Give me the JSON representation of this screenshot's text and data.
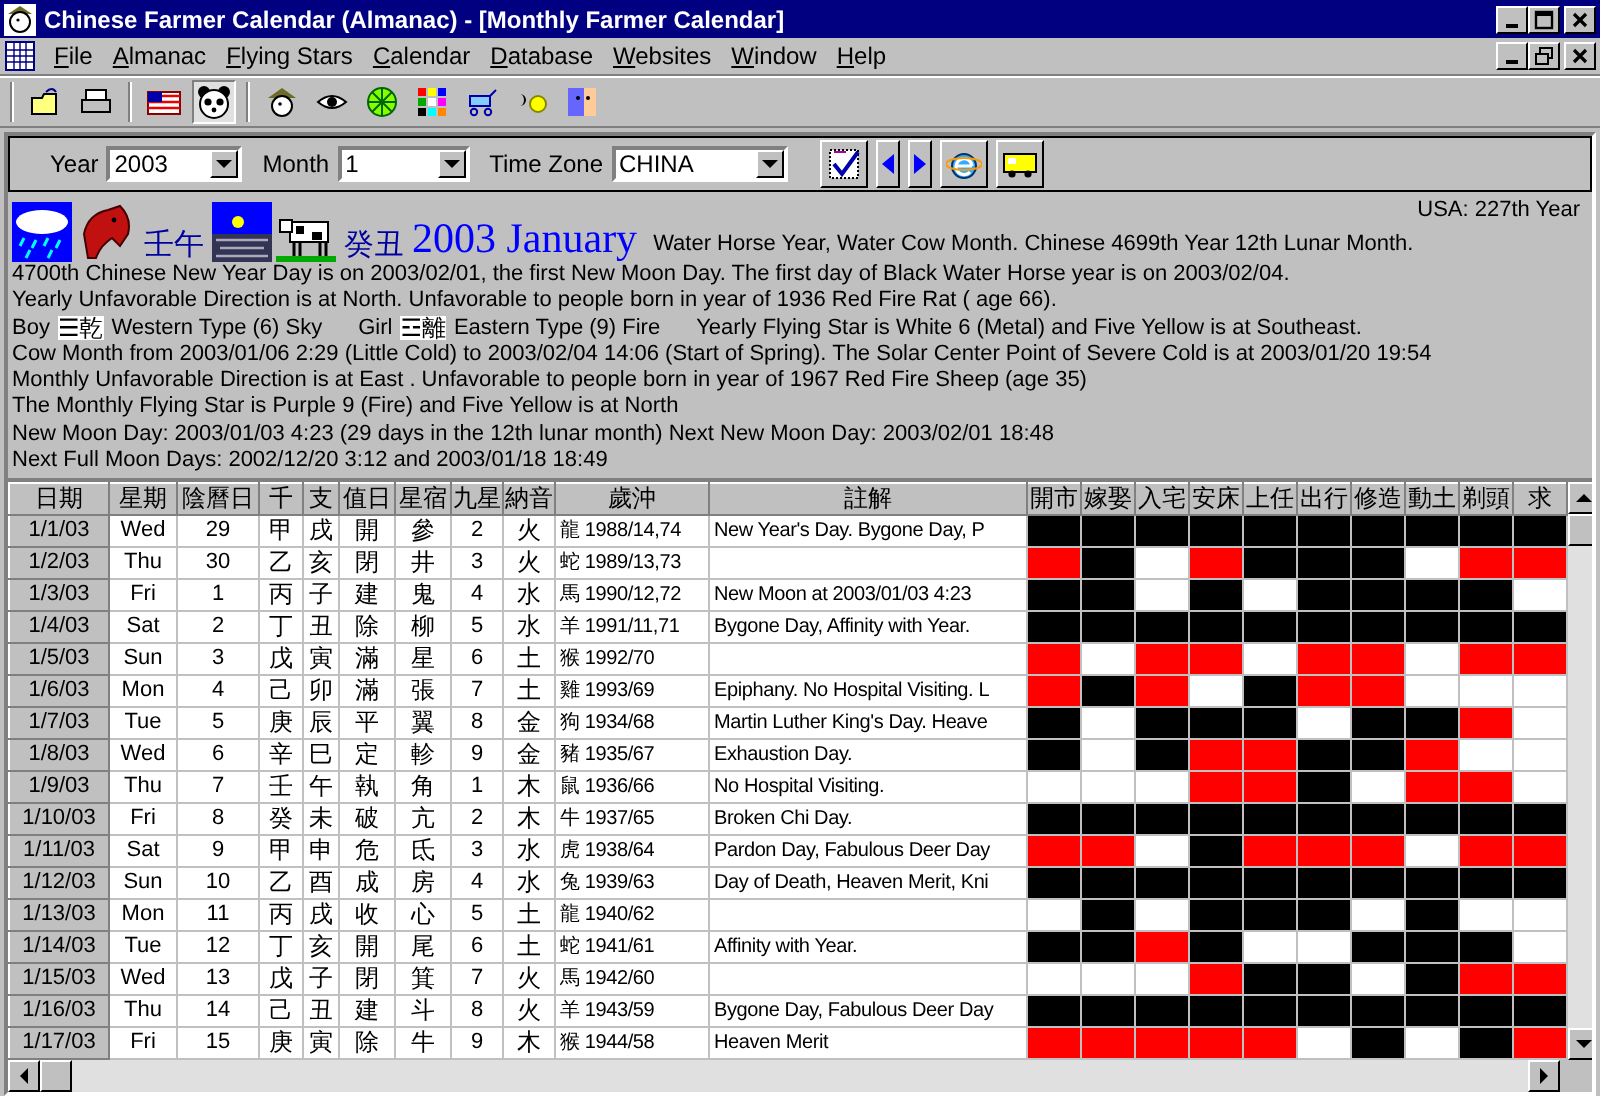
{
  "window": {
    "title": "Chinese Farmer Calendar (Almanac) - [Monthly Farmer Calendar]"
  },
  "menu": [
    "File",
    "Almanac",
    "Flying Stars",
    "Calendar",
    "Database",
    "Websites",
    "Window",
    "Help"
  ],
  "selectors": [
    {
      "label": "Year",
      "value": "2003"
    },
    {
      "label": "Month",
      "value": "1"
    },
    {
      "label": "Time Zone",
      "value": "CHINA"
    }
  ],
  "header": {
    "year_ganzhi": "壬午",
    "month_ganzhi": "癸丑",
    "heading": "2003 January",
    "summary": "Water Horse Year, Water Cow Month. Chinese 4699th Year 12th Lunar Month.",
    "usa_year": "USA: 227th Year",
    "lines_before": [
      "4700th Chinese New Year Day is on 2003/02/01, the first New Moon Day. The first day of Black Water Horse year is on 2003/02/04.",
      "Yearly Unfavorable Direction is at North. Unfavorable to people born in year of 1936 Red Fire Rat ( age 66)."
    ],
    "trigrams": [
      {
        "label": "Boy",
        "symbol": "☰",
        "name": "乾",
        "type": "Western Type (6) Sky"
      },
      {
        "label": "Girl",
        "symbol": "☲",
        "name": "離",
        "type": "Eastern Type (9) Fire"
      }
    ],
    "flying_star": "Yearly Flying Star is White 6 (Metal) and Five Yellow is at Southeast.",
    "lines_after": [
      "Cow Month from 2003/01/06 2:29 (Little Cold) to 2003/02/04 14:06 (Start of Spring). The Solar Center Point of Severe Cold is at 2003/01/20 19:54",
      "Monthly Unfavorable Direction is at East . Unfavorable to people born in year of 1967 Red Fire Sheep (age 35)",
      "The Monthly Flying Star is Purple 9 (Fire) and Five Yellow is at North",
      "New Moon Day: 2003/01/03 4:23 (29 days in the 12th lunar month) Next New Moon Day: 2003/02/01 18:48",
      "Next Full Moon Days: 2002/12/20 3:12 and 2003/01/18 18:49"
    ]
  },
  "table": {
    "columns": [
      "日期",
      "星期",
      "陰曆日",
      "千",
      "支",
      "值日",
      "星宿",
      "九星",
      "納音",
      "歲沖",
      "註解"
    ],
    "activity_columns": [
      "開市",
      "嫁娶",
      "入宅",
      "安床",
      "上任",
      "出行",
      "修造",
      "動土",
      "剃頭",
      "求"
    ],
    "rows": [
      {
        "cells": [
          "1/1/03",
          "Wed",
          "29",
          "甲",
          "戌",
          "開",
          "參",
          "2",
          "火",
          "龍 1988/14,74",
          "New Year's Day. Bygone Day, P"
        ],
        "marks": [
          {
            "color": "#000000"
          },
          {
            "color": "#000000"
          },
          {
            "color": "#000000"
          },
          {
            "color": "#000000"
          },
          {
            "color": "#000000"
          },
          {
            "color": "#000000"
          },
          {
            "color": "#000000"
          },
          {
            "color": "#000000"
          },
          {
            "color": "#000000"
          },
          {
            "color": "#000000"
          }
        ]
      },
      {
        "cells": [
          "1/2/03",
          "Thu",
          "30",
          "乙",
          "亥",
          "閉",
          "井",
          "3",
          "火",
          "蛇 1989/13,73"
        ],
        "marks": [
          {
            "color": "#ff0000"
          },
          {
            "color": "#000000"
          },
          {
            "color": "#ffffff"
          },
          {
            "color": "#ff0000"
          },
          {
            "color": "#000000"
          },
          {
            "color": "#000000"
          },
          {
            "color": "#000000"
          },
          {
            "color": "#ffffff"
          },
          {
            "color": "#ff0000"
          },
          {
            "color": "#ff0000"
          }
        ]
      },
      {
        "cells": [
          "1/3/03",
          "Fri",
          "1",
          "丙",
          "子",
          "建",
          "鬼",
          "4",
          "水",
          "馬 1990/12,72",
          "New Moon at 2003/01/03 4:23"
        ],
        "marks": [
          {
            "color": "#000000"
          },
          {
            "color": "#000000"
          },
          {
            "color": "#ffffff"
          },
          {
            "color": "#000000"
          },
          {
            "color": "#ffffff"
          },
          {
            "color": "#000000"
          },
          {
            "color": "#000000"
          },
          {
            "color": "#000000"
          },
          {
            "color": "#000000"
          },
          {
            "color": "#ffffff"
          }
        ]
      },
      {
        "cells": [
          "1/4/03",
          "Sat",
          "2",
          "丁",
          "丑",
          "除",
          "柳",
          "5",
          "水",
          "羊 1991/11,71",
          "Bygone Day, Affinity with Year."
        ],
        "marks": [
          {
            "color": "#000000"
          },
          {
            "color": "#000000"
          },
          {
            "color": "#000000"
          },
          {
            "color": "#000000"
          },
          {
            "color": "#000000"
          },
          {
            "color": "#000000"
          },
          {
            "color": "#000000"
          },
          {
            "color": "#000000"
          },
          {
            "color": "#000000"
          },
          {
            "color": "#000000"
          }
        ]
      },
      {
        "cells": [
          "1/5/03",
          "Sun",
          "3",
          "戊",
          "寅",
          "滿",
          "星",
          "6",
          "土",
          "猴 1992/70"
        ],
        "marks": [
          {
            "color": "#ff0000"
          },
          {
            "color": "#ffffff"
          },
          {
            "color": "#ff0000"
          },
          {
            "color": "#ff0000"
          },
          {
            "color": "#ffffff"
          },
          {
            "color": "#ff0000"
          },
          {
            "color": "#ff0000"
          },
          {
            "color": "#ffffff"
          },
          {
            "color": "#ff0000"
          },
          {
            "color": "#ff0000"
          }
        ]
      },
      {
        "cells": [
          "1/6/03",
          "Mon",
          "4",
          "己",
          "卯",
          "滿",
          "張",
          "7",
          "土",
          "雞 1993/69",
          "Epiphany. No Hospital Visiting. L"
        ],
        "marks": [
          {
            "color": "#ff0000"
          },
          {
            "color": "#000000"
          },
          {
            "color": "#ff0000"
          },
          {
            "color": "#ffffff"
          },
          {
            "color": "#000000"
          },
          {
            "color": "#ff0000"
          },
          {
            "color": "#ff0000"
          },
          {
            "color": "#ffffff"
          },
          {
            "color": "#ffffff"
          },
          {
            "color": "#ffffff"
          }
        ]
      },
      {
        "cells": [
          "1/7/03",
          "Tue",
          "5",
          "庚",
          "辰",
          "平",
          "翼",
          "8",
          "金",
          "狗 1934/68",
          "Martin Luther King's Day. Heave"
        ],
        "marks": [
          {
            "color": "#000000"
          },
          {
            "color": "#ffffff"
          },
          {
            "color": "#000000"
          },
          {
            "color": "#000000"
          },
          {
            "color": "#000000"
          },
          {
            "color": "#ffffff"
          },
          {
            "color": "#000000"
          },
          {
            "color": "#000000"
          },
          {
            "color": "#ff0000"
          },
          {
            "color": "#ffffff"
          }
        ]
      },
      {
        "cells": [
          "1/8/03",
          "Wed",
          "6",
          "辛",
          "巳",
          "定",
          "軫",
          "9",
          "金",
          "豬 1935/67",
          "Exhaustion Day."
        ],
        "marks": [
          {
            "color": "#000000"
          },
          {
            "color": "#ffffff"
          },
          {
            "color": "#000000"
          },
          {
            "color": "#ff0000"
          },
          {
            "color": "#ff0000"
          },
          {
            "color": "#000000"
          },
          {
            "color": "#000000"
          },
          {
            "color": "#ff0000"
          },
          {
            "color": "#ffffff"
          },
          {
            "color": "#ffffff"
          }
        ]
      },
      {
        "cells": [
          "1/9/03",
          "Thu",
          "7",
          "壬",
          "午",
          "執",
          "角",
          "1",
          "木",
          "鼠 1936/66",
          "No Hospital Visiting."
        ],
        "marks": [
          {
            "color": "#ffffff"
          },
          {
            "color": "#ffffff"
          },
          {
            "color": "#ffffff"
          },
          {
            "color": "#ff0000"
          },
          {
            "color": "#ff0000"
          },
          {
            "color": "#000000"
          },
          {
            "color": "#ffffff"
          },
          {
            "color": "#ff0000"
          },
          {
            "color": "#ff0000"
          },
          {
            "color": "#ffffff"
          }
        ]
      },
      {
        "cells": [
          "1/10/03",
          "Fri",
          "8",
          "癸",
          "未",
          "破",
          "亢",
          "2",
          "木",
          "牛 1937/65",
          "Broken Chi Day."
        ],
        "marks": [
          {
            "color": "#000000"
          },
          {
            "color": "#000000"
          },
          {
            "color": "#000000"
          },
          {
            "color": "#000000"
          },
          {
            "color": "#000000"
          },
          {
            "color": "#000000"
          },
          {
            "color": "#000000"
          },
          {
            "color": "#000000"
          },
          {
            "color": "#000000"
          },
          {
            "color": "#000000"
          }
        ]
      },
      {
        "cells": [
          "1/11/03",
          "Sat",
          "9",
          "甲",
          "申",
          "危",
          "氐",
          "3",
          "水",
          "虎 1938/64",
          "Pardon Day, Fabulous Deer Day"
        ],
        "marks": [
          {
            "color": "#ff0000"
          },
          {
            "color": "#ff0000"
          },
          {
            "color": "#ffffff"
          },
          {
            "color": "#000000"
          },
          {
            "color": "#ff0000"
          },
          {
            "color": "#ff0000"
          },
          {
            "color": "#ff0000"
          },
          {
            "color": "#ffffff"
          },
          {
            "color": "#ff0000"
          },
          {
            "color": "#ff0000"
          }
        ]
      },
      {
        "cells": [
          "1/12/03",
          "Sun",
          "10",
          "乙",
          "酉",
          "成",
          "房",
          "4",
          "水",
          "兔 1939/63",
          "Day of Death, Heaven Merit, Kni"
        ],
        "marks": [
          {
            "color": "#000000"
          },
          {
            "color": "#000000"
          },
          {
            "color": "#000000"
          },
          {
            "color": "#000000"
          },
          {
            "color": "#000000"
          },
          {
            "color": "#000000"
          },
          {
            "color": "#000000"
          },
          {
            "color": "#000000"
          },
          {
            "color": "#000000"
          },
          {
            "color": "#000000"
          }
        ]
      },
      {
        "cells": [
          "1/13/03",
          "Mon",
          "11",
          "丙",
          "戌",
          "收",
          "心",
          "5",
          "土",
          "龍 1940/62"
        ],
        "marks": [
          {
            "color": "#ffffff"
          },
          {
            "color": "#000000"
          },
          {
            "color": "#ffffff"
          },
          {
            "color": "#000000"
          },
          {
            "color": "#000000"
          },
          {
            "color": "#000000"
          },
          {
            "color": "#ffffff"
          },
          {
            "color": "#000000"
          },
          {
            "color": "#ffffff"
          },
          {
            "color": "#ffffff"
          }
        ]
      },
      {
        "cells": [
          "1/14/03",
          "Tue",
          "12",
          "丁",
          "亥",
          "開",
          "尾",
          "6",
          "土",
          "蛇 1941/61",
          "Affinity with Year."
        ],
        "marks": [
          {
            "color": "#000000"
          },
          {
            "color": "#000000"
          },
          {
            "color": "#ff0000"
          },
          {
            "color": "#000000"
          },
          {
            "color": "#ffffff"
          },
          {
            "color": "#ffffff"
          },
          {
            "color": "#000000"
          },
          {
            "color": "#000000"
          },
          {
            "color": "#000000"
          },
          {
            "color": "#ffffff"
          }
        ]
      },
      {
        "cells": [
          "1/15/03",
          "Wed",
          "13",
          "戊",
          "子",
          "閉",
          "箕",
          "7",
          "火",
          "馬 1942/60"
        ],
        "marks": [
          {
            "color": "#ffffff"
          },
          {
            "color": "#ffffff"
          },
          {
            "color": "#ffffff"
          },
          {
            "color": "#ff0000"
          },
          {
            "color": "#000000"
          },
          {
            "color": "#000000"
          },
          {
            "color": "#ffffff"
          },
          {
            "color": "#000000"
          },
          {
            "color": "#ff0000"
          },
          {
            "color": "#ff0000"
          }
        ]
      },
      {
        "cells": [
          "1/16/03",
          "Thu",
          "14",
          "己",
          "丑",
          "建",
          "斗",
          "8",
          "火",
          "羊 1943/59",
          "Bygone Day, Fabulous Deer Day"
        ],
        "marks": [
          {
            "color": "#000000"
          },
          {
            "color": "#000000"
          },
          {
            "color": "#000000"
          },
          {
            "color": "#000000"
          },
          {
            "color": "#000000"
          },
          {
            "color": "#000000"
          },
          {
            "color": "#000000"
          },
          {
            "color": "#000000"
          },
          {
            "color": "#000000"
          },
          {
            "color": "#000000"
          }
        ]
      },
      {
        "cells": [
          "1/17/03",
          "Fri",
          "15",
          "庚",
          "寅",
          "除",
          "牛",
          "9",
          "木",
          "猴 1944/58",
          "Heaven Merit"
        ],
        "marks": [
          {
            "color": "#ff0000"
          },
          {
            "color": "#ff0000"
          },
          {
            "color": "#ff0000"
          },
          {
            "color": "#ff0000"
          },
          {
            "color": "#ff0000"
          },
          {
            "color": "#ffffff"
          },
          {
            "color": "#000000"
          },
          {
            "color": "#ffffff"
          },
          {
            "color": "#000000"
          },
          {
            "color": "#ff0000"
          }
        ]
      }
    ]
  }
}
